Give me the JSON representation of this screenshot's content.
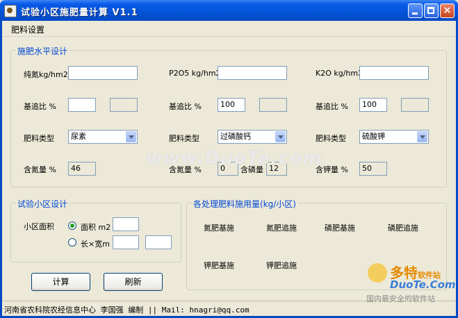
{
  "window": {
    "title": "试验小区施肥量计算 V1.1"
  },
  "menu": {
    "items": [
      "肥料设置"
    ]
  },
  "fert_group": {
    "title": "施肥水平设计",
    "n": {
      "label": "纯氮kg/hm2",
      "value": "",
      "ratio_label": "基追比 %",
      "ratio_value": "",
      "ratio_extra": "",
      "type_label": "肥料类型",
      "type_value": "尿素",
      "content_label": "含氮量 %",
      "content_value": "46"
    },
    "p": {
      "label": "P2O5 kg/hm2",
      "value": "",
      "ratio_label": "基追比 %",
      "ratio_value": "100",
      "ratio_extra": "",
      "type_label": "肥料类型",
      "type_value": "过磷酸钙",
      "content_label": "含氮量 %",
      "content_value": "0",
      "content2_label": "含磷量",
      "content2_value": "12"
    },
    "k": {
      "label": "K2O kg/hm2",
      "value": "",
      "ratio_label": "基追比 %",
      "ratio_value": "100",
      "ratio_extra": "",
      "type_label": "肥料类型",
      "type_value": "硫酸钾",
      "content_label": "含钾量 %",
      "content_value": "50"
    }
  },
  "plot_group": {
    "title": "试验小区设计",
    "area_label": "小区面积",
    "option_area": "面积 m2",
    "option_lw": "长×宽m",
    "area_value": "",
    "length_value": "",
    "width_value": ""
  },
  "result_group": {
    "title": "各处理肥料施用量(kg/小区)",
    "labels": [
      "氮肥基施",
      "氮肥追施",
      "磷肥基施",
      "磷肥追施",
      "钾肥基施",
      "钾肥追施"
    ]
  },
  "buttons": {
    "calc": "计算",
    "refresh": "刷新"
  },
  "status": {
    "text": "河南省农科院农经信息中心 李国强 编制 || Mail: hnagri@qq.com"
  },
  "watermark": {
    "center": "www.DuoTe.com",
    "logo_cn": "多特",
    "logo_cn_small": "软件站",
    "logo_en": "DuoTe.Com",
    "logo_slogan": "国内最安全的软件站"
  },
  "colors": {
    "titlebar": "#0453d8",
    "group_title": "#0046d5",
    "body": "#ece9d8"
  }
}
